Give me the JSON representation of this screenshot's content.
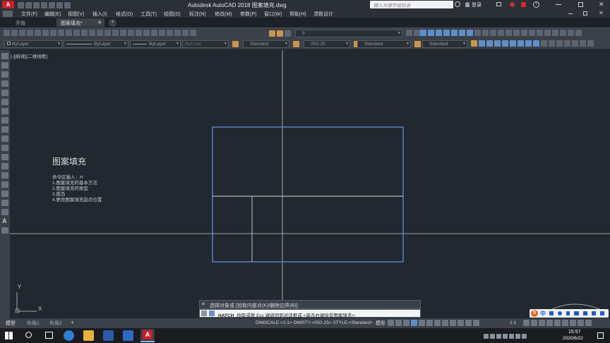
{
  "app": {
    "title": "Autodesk AutoCAD 2018    图案填充.dwg",
    "search_placeholder": "键入关键字或短语",
    "login_label": "登录"
  },
  "menu": [
    "文件(F)",
    "编辑(E)",
    "视图(V)",
    "插入(I)",
    "格式(O)",
    "工具(T)",
    "绘图(D)",
    "标注(N)",
    "修改(M)",
    "参数(P)",
    "窗口(W)",
    "帮助(H)",
    "漂数设计"
  ],
  "tabs": [
    {
      "label": "开始"
    },
    {
      "label": "图案填充*"
    }
  ],
  "add_tab_label": "+",
  "layer_value": "0",
  "properties": {
    "color": "ByLayer",
    "linetype": "ByLayer",
    "lineweight": "ByLayer",
    "plotstyle": "ByColor",
    "text_style": "Standard",
    "dim_style": "ISO-25",
    "table_style": "Standard",
    "multileader_style": "Standard"
  },
  "viewport": {
    "label": "[-][俯视][二维线框]"
  },
  "notes": {
    "heading": "图案填充",
    "lines": [
      "命令区输入：H",
      "1.图案填充的基本方法",
      "2.图案填充的类型",
      "3.孤岛",
      "4.更改图案填充起点位置"
    ]
  },
  "ucs": {
    "y": "Y",
    "x": "X"
  },
  "command": {
    "history": "选择对象或 [拾取内部点(K)/删除边界(B)]:",
    "prompt_prefix": "HATCH",
    "prompt": "拾取或按 Esc 键返回到对话框或 <单击右键接受图案填充>:"
  },
  "layout_tabs": [
    "模型",
    "布局1",
    "布局2"
  ],
  "layout_add": "+",
  "status": {
    "dim_info": "DIMSCALE:<1:1> DIMSTY:<ISO-25> STYLE:<Standard>",
    "model_label": "模型",
    "scale_label": "1:1"
  },
  "ime": {
    "label": "中"
  },
  "clock": {
    "time": "15:57",
    "date": "2020/6/22"
  },
  "colors": {
    "canvas_bg": "#212830",
    "rect_stroke": "#5f8fe0",
    "crosshair": "#c8c8c8",
    "autocad_red": "#c8202a"
  }
}
